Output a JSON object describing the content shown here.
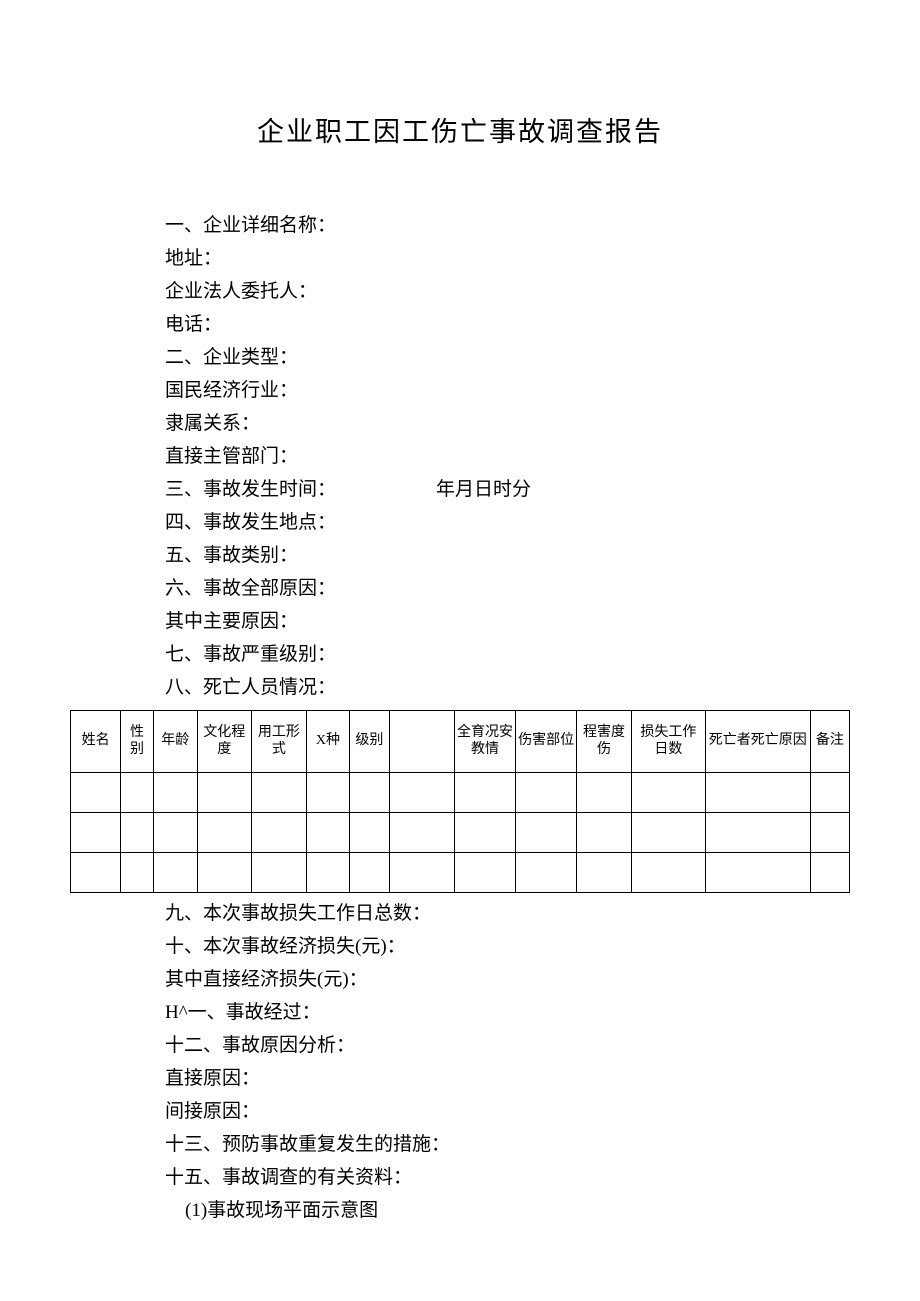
{
  "title": "企业职工因工伤亡事故调查报告",
  "lines": {
    "l1": "一、企业详细名称：",
    "l2": "地址：",
    "l3": "企业法人委托人：",
    "l4": "电话：",
    "l5": "二、企业类型：",
    "l6": "国民经济行业：",
    "l7": "隶属关系：",
    "l8": "直接主管部门：",
    "l9a": "三、事故发生时间：",
    "l9b": "年月日时分",
    "l10": "四、事故发生地点：",
    "l11": "五、事故类别：",
    "l12": "六、事故全部原因：",
    "l13": "其中主要原因：",
    "l14": "七、事故严重级别：",
    "l15": "八、死亡人员情况：",
    "l16": "九、本次事故损失工作日总数：",
    "l17": "十、本次事故经济损失(元)：",
    "l18": "其中直接经济损失(元)：",
    "l19": "H^一、事故经过：",
    "l20": "十二、事故原因分析：",
    "l21": "直接原因：",
    "l22": "间接原因：",
    "l23": "十三、预防事故重复发生的措施：",
    "l24": "十五、事故调查的有关资料：",
    "l25": "(1)事故现场平面示意图"
  },
  "table": {
    "headers": {
      "c1": "姓名",
      "c2": "性别",
      "c3": "年龄",
      "c4": "文化程度",
      "c5": "用工形式",
      "c6": "X种",
      "c7": "级别",
      "c8": "",
      "c9": "全育况安教情",
      "c10": "伤害部位",
      "c11": "程害度伤",
      "c12": "损失工作日数",
      "c13": "死亡者死亡原因",
      "c14": "备注"
    }
  }
}
